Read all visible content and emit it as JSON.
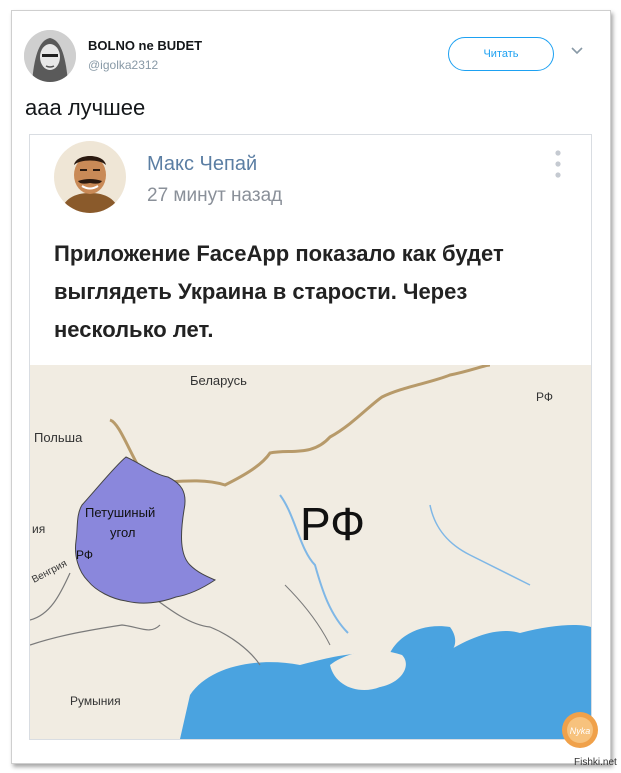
{
  "tweet": {
    "display_name": "BOLNO ne BUDET",
    "handle": "@igolka2312",
    "follow_label": "Читать",
    "text": "ааа лучшее"
  },
  "vk_post": {
    "author": "Макс Чепай",
    "time": "27 минут назад",
    "text": "Приложение FaceApp показало как будет выглядеть Украина в старости. Через несколько лет."
  },
  "map": {
    "labels": {
      "belarus": "Беларусь",
      "poland": "Польша",
      "rf_corner": "РФ",
      "rf_big": "РФ",
      "region_line1": "Петушиный",
      "region_line2": "угол",
      "hungary": "Венгрия",
      "rf_small": "РФ",
      "romania": "Румыния",
      "slovakia_cut": "ия"
    },
    "colors": {
      "land": "#f1ece2",
      "sea": "#4aa3e0",
      "region": "#8a87dc",
      "border": "#b79a6a"
    }
  },
  "watermark": {
    "badge": "Nyka",
    "site": "Fishki.net"
  }
}
